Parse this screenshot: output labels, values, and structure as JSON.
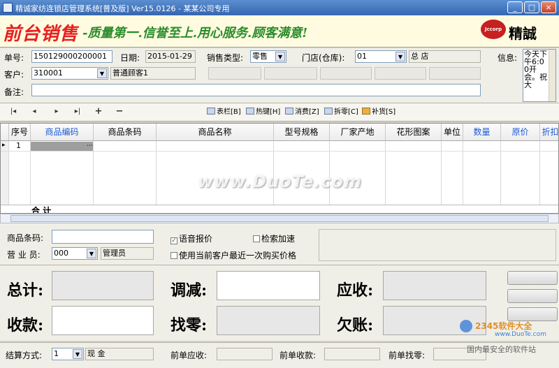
{
  "window": {
    "title": "精诚家纺连锁店管理系统[普及版] Ver15.0126  -  某某公司专用"
  },
  "banner": {
    "title": "前台销售",
    "slogan": "-质量第一.信誉至上.用心服务.顾客满意!",
    "logo_text": "Jccorp",
    "logo_name": "精誠"
  },
  "form": {
    "doc_no_label": "单号:",
    "doc_no": "150129000200001",
    "date_label": "日期:",
    "date": "2015-01-29",
    "sale_type_label": "销售类型:",
    "sale_type": "零售",
    "store_label": "门店(仓库):",
    "store_code": "01",
    "store_name": "总  店",
    "info_label": "信息:",
    "customer_label": "客户:",
    "customer_code": "310001",
    "customer_name": "普通顾客1",
    "remark_label": "备注:",
    "notice_text": "今天下午6:00开会。祝大"
  },
  "toolbar": {
    "nav": [
      "|◂",
      "◂",
      "▸",
      "▸|",
      "+",
      "−"
    ],
    "buttons": [
      "表栏[B]",
      "热键[H]",
      "消费[Z]",
      "拆零[C]",
      "补货[S]"
    ]
  },
  "grid": {
    "headers": [
      "序号",
      "商品编码",
      "商品条码",
      "商品名称",
      "型号规格",
      "厂家产地",
      "花形图案",
      "单位",
      "数量",
      "原价",
      "折扣"
    ],
    "row_index": "1",
    "sum_label": "合  计"
  },
  "mid": {
    "barcode_label": "商品条码:",
    "clerk_label": "营 业 员:",
    "clerk_code": "000",
    "clerk_name": "管理员",
    "voice_label": "语音报价",
    "search_label": "检索加速",
    "last_price_label": "使用当前客户最近一次购买价格"
  },
  "totals": {
    "total_label": "总计:",
    "adjust_label": "调减:",
    "receivable_label": "应收:",
    "received_label": "收款:",
    "change_label": "找零:",
    "owed_label": "欠账:"
  },
  "bottom": {
    "pay_label": "结算方式:",
    "pay_code": "1",
    "pay_name": "现  金",
    "prev_receivable_label": "前单应收:",
    "prev_received_label": "前单收款:",
    "prev_change_label": "前单找零:"
  },
  "watermark": {
    "main": "www.DuoTe.com",
    "site1": "2345软件大全",
    "site2": "www.DuoTe.com",
    "site3": "国内最安全的软件站"
  },
  "colors": {
    "title_bar": "#3566b0",
    "brand_red": "#e62020",
    "slogan_green": "#2a8c2a",
    "header_blue": "#1e5bd6"
  }
}
